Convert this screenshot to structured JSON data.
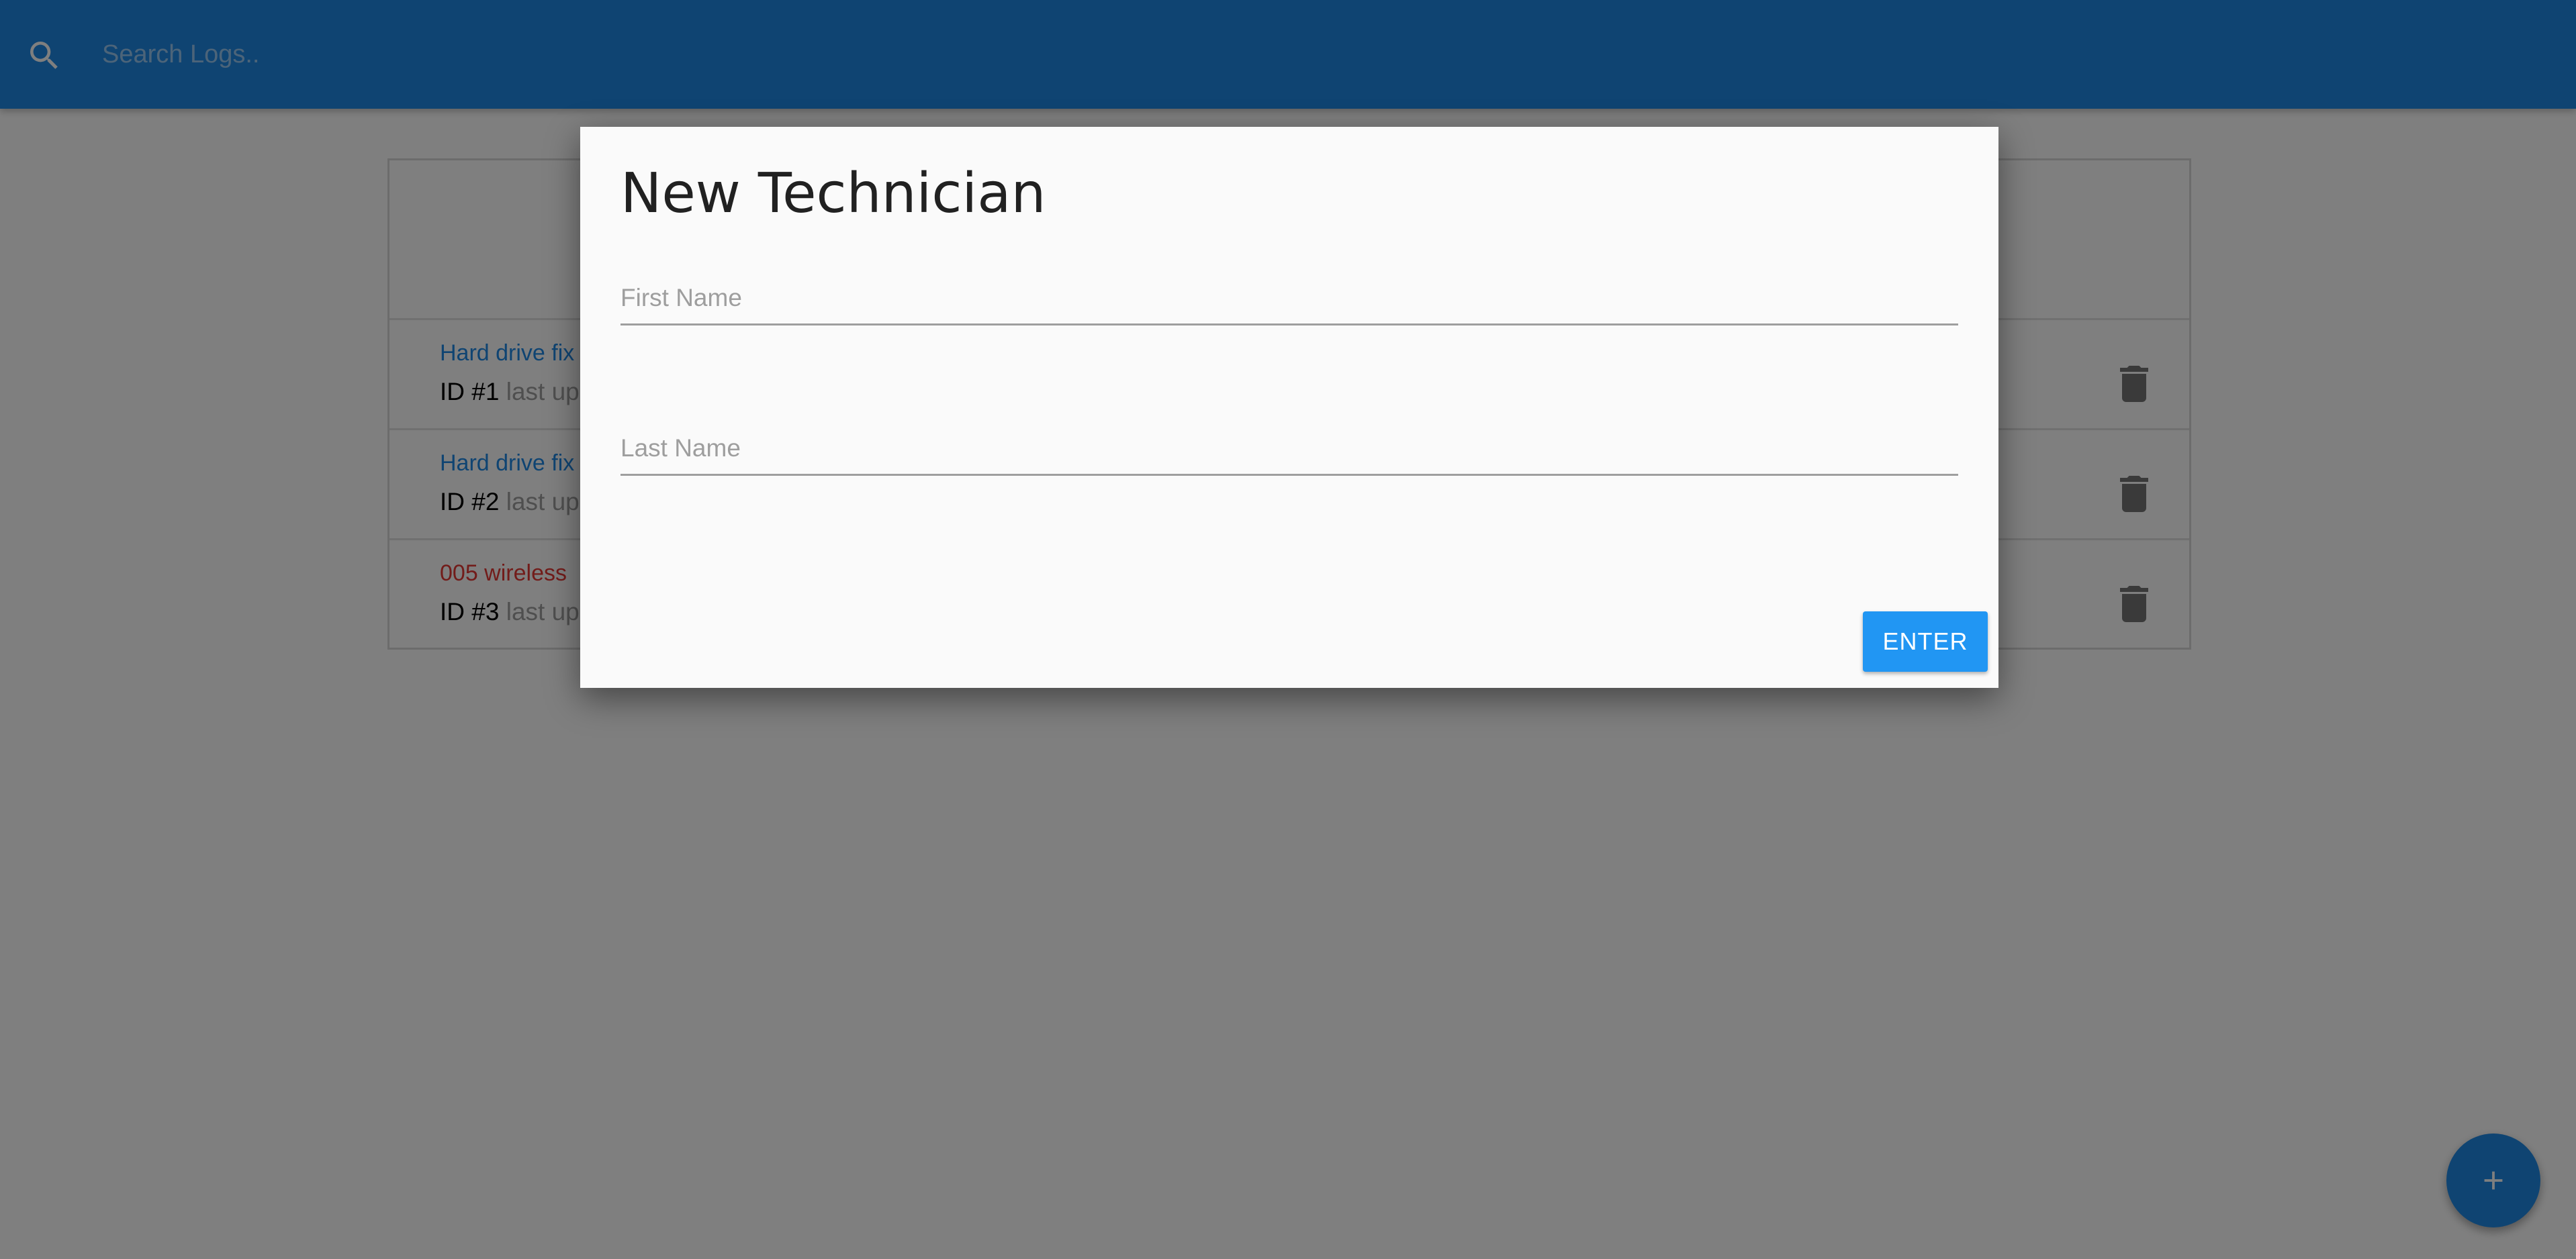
{
  "topbar": {
    "search_placeholder": "Search Logs..",
    "search_value": ""
  },
  "logs": [
    {
      "message": "Hard drive fix",
      "id_label": "ID #1",
      "updated_label": "last up",
      "attention": false
    },
    {
      "message": "Hard drive fix",
      "id_label": "ID #2",
      "updated_label": "last up",
      "attention": false
    },
    {
      "message": "005 wireless",
      "id_label": "ID #3",
      "updated_label": "last up",
      "attention": true
    }
  ],
  "modal": {
    "title": "New Technician",
    "first_name_placeholder": "First Name",
    "first_name_value": "",
    "last_name_placeholder": "Last Name",
    "last_name_value": "",
    "enter_label": "ENTER"
  },
  "fab": {
    "icon": "plus-icon"
  },
  "colors": {
    "primary": "#1e88e5",
    "attention": "#e53935",
    "button": "#2196f3",
    "overlay": "rgba(0,0,0,0.5)"
  },
  "icons": {
    "search": "search-icon",
    "delete": "trash-icon",
    "add": "plus-icon"
  }
}
